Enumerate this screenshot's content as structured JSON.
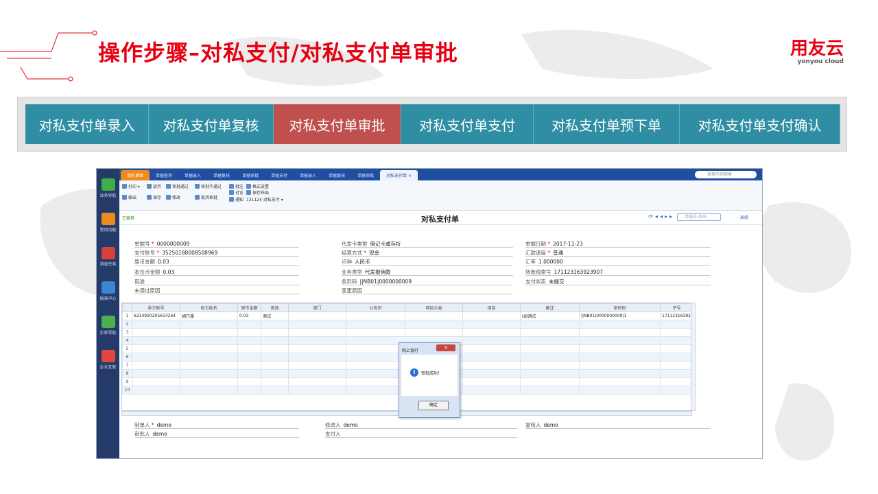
{
  "header": {
    "title": "操作步骤–对私支付/对私支付单审批",
    "brand_cn": "用友云",
    "brand_en": "yonyou cloud"
  },
  "steps": [
    {
      "label": "对私支付单录入",
      "active": false
    },
    {
      "label": "对私支付单复核",
      "active": false
    },
    {
      "label": "对私支付单审批",
      "active": true
    },
    {
      "label": "对私支付单支付",
      "active": false
    },
    {
      "label": "对私支付单预下单",
      "active": false
    },
    {
      "label": "对私支付单支付确认",
      "active": false
    }
  ],
  "colors": {
    "accent_red": "#e60012",
    "step_blue": "#2f8ea4",
    "step_active": "#c0504d"
  },
  "app": {
    "sidebar": [
      "业务导航",
      "常用功能",
      "消息任务",
      "报表中心",
      "实验导航",
      "企业互联"
    ],
    "tabs": [
      "我的桌面",
      "单据查询",
      "单据录入",
      "单据复核",
      "单据审批",
      "单据支付",
      "单据录入",
      "单据复核",
      "单据审批",
      "对私支付单 ×"
    ],
    "search_placeholder": "单据示例搜索",
    "toolbar": {
      "print": "打印 ▾",
      "discard": "放弃",
      "approve_pass": "审批通过",
      "approve_fail": "审批不通过",
      "annotate": "批注",
      "format": "格式设置",
      "export": "输出",
      "save": "保存",
      "modify": "修改",
      "cancel_approve": "取消审批",
      "discuss": "讨论",
      "save_layout": "保存布局",
      "notify": "通知",
      "layout_name": "131124 对私支付 ▾"
    },
    "form_status": "已复核",
    "form_title": "对私支付单",
    "nav_placeholder": "单据号/条码",
    "advanced": "高级",
    "fields": {
      "bill_no_label": "单据号",
      "bill_no": "0000000009",
      "pay_account_label": "支付账号",
      "pay_account": "35250188008508969",
      "orig_amount_label": "原币金额",
      "orig_amount": "0.03",
      "local_amount_label": "本位币金额",
      "local_amount": "0.03",
      "purpose_label": "用途",
      "purpose": "",
      "reject_reason_label": "未通过原因",
      "reject_reason": "",
      "card_type_label": "代发卡类型",
      "card_type": "借记卡或存折",
      "settle_label": "结算方式",
      "settle": "现金",
      "currency_label": "币种",
      "currency": "人民币",
      "biz_type_label": "业务类型",
      "biz_type": "代发报销款",
      "barcode_label": "条形码",
      "barcode": "||NB01|0000000009",
      "change_reason_label": "变更原因",
      "change_reason": "",
      "date_label": "单据日期",
      "date": "2017-11-23",
      "speed_label": "汇款速度",
      "speed": "普通",
      "rate_label": "汇率",
      "rate": "1.000000",
      "txn_label": "转账线索号",
      "txn": "171123163923907",
      "pay_status_label": "支付状态",
      "pay_status": "未提交",
      "maker_label": "制单人",
      "maker": "demo",
      "modifier_label": "修改人",
      "modifier": "demo",
      "reviewer_label": "复核人",
      "reviewer": "demo",
      "approver_label": "审批人",
      "approver": "demo",
      "payer_label": "支付人",
      "payer": ""
    },
    "grid": {
      "columns": [
        "",
        "收方账号",
        "收方姓名",
        "原币金额",
        "用途",
        "部门",
        "业务员",
        "项目大类",
        "项目",
        "备注",
        "条形码",
        "子号"
      ],
      "rows": [
        [
          "1",
          "6214920205614264",
          "胡乃操",
          "0.03",
          "测试",
          "",
          "",
          "",
          "",
          "UB测试",
          "||NB01|0000000009|1",
          "171123163923"
        ],
        [
          "2",
          "",
          "",
          "",
          "",
          "",
          "",
          "",
          "",
          "",
          "",
          ""
        ],
        [
          "3",
          "",
          "",
          "",
          "",
          "",
          "",
          "",
          "",
          "",
          "",
          ""
        ],
        [
          "4",
          "",
          "",
          "",
          "",
          "",
          "",
          "",
          "",
          "",
          "",
          ""
        ],
        [
          "5",
          "",
          "",
          "",
          "",
          "",
          "",
          "",
          "",
          "",
          "",
          ""
        ],
        [
          "6",
          "",
          "",
          "",
          "",
          "",
          "",
          "",
          "",
          "",
          "",
          ""
        ],
        [
          "7",
          "",
          "",
          "",
          "",
          "",
          "",
          "",
          "",
          "",
          "",
          ""
        ],
        [
          "8",
          "",
          "",
          "",
          "",
          "",
          "",
          "",
          "",
          "",
          "",
          ""
        ],
        [
          "9",
          "",
          "",
          "",
          "",
          "",
          "",
          "",
          "",
          "",
          "",
          ""
        ],
        [
          "10",
          "",
          "",
          "",
          "",
          "",
          "",
          "",
          "",
          "",
          "",
          ""
        ]
      ]
    },
    "dialog": {
      "title": "网上银行",
      "close": "✕",
      "message": "审批成功！",
      "ok": "确定"
    }
  }
}
